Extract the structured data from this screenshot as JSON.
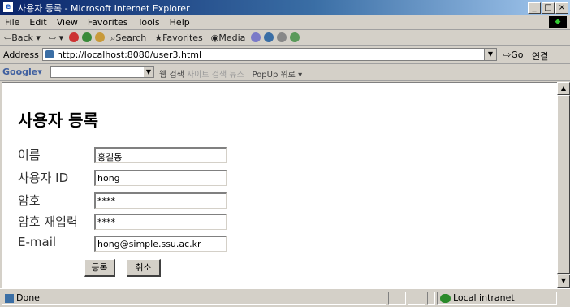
{
  "window": {
    "title": "사용자 등록 - Microsoft Internet Explorer",
    "minimize": "_",
    "maximize": "□",
    "close": "×"
  },
  "menu": [
    "File",
    "Edit",
    "View",
    "Favorites",
    "Tools",
    "Help"
  ],
  "toolbar": {
    "back": "Back",
    "search": "Search",
    "favorites": "Favorites",
    "media": "Media"
  },
  "address": {
    "label": "Address",
    "url": "http://localhost:8080/user3.html",
    "go": "Go",
    "links": "연결"
  },
  "googlebar": {
    "logo": "Google",
    "search_button": "웹 검색",
    "site_search": "사이트 검색",
    "news": "뉴스",
    "popup": "PopUp",
    "up": "위로"
  },
  "page": {
    "title": "사용자 등록",
    "fields": [
      {
        "label": "이름",
        "value": "홍길동"
      },
      {
        "label": "사용자 ID",
        "value": "hong"
      },
      {
        "label": "암호",
        "value": "****"
      },
      {
        "label": "암호 재입력",
        "value": "****"
      },
      {
        "label": "E-mail",
        "value": "hong@simple.ssu.ac.kr"
      }
    ],
    "submit": "등록",
    "cancel": "취소"
  },
  "status": {
    "text": "Done",
    "zone": "Local intranet"
  },
  "colors": {
    "titlebar_start": "#0a246a",
    "titlebar_end": "#a6caf0",
    "chrome": "#d4d0c8"
  }
}
